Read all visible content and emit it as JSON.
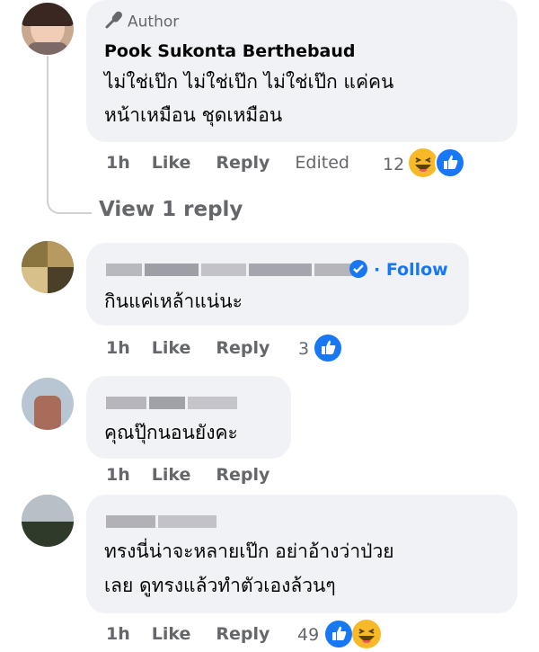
{
  "comment1": {
    "badge": "Author",
    "name": "Pook Sukonta Berthebaud",
    "line1": "ไม่ใช่เป๊ก ไม่ใช่เป๊ก ไม่ใช่เป๊ก แค่คน",
    "line2": "หน้าเหมือน ชุดเหมือน",
    "time": "1h",
    "like": "Like",
    "reply": "Reply",
    "edited": "Edited",
    "reaction_count": "12"
  },
  "view_replies": "View 1 reply",
  "comment2": {
    "follow": "· Follow",
    "text": "กินแค่เหล้าแน่นะ",
    "time": "1h",
    "like": "Like",
    "reply": "Reply",
    "reaction_count": "3"
  },
  "comment3": {
    "text": "คุณปุ๊กนอนยังคะ",
    "time": "1h",
    "like": "Like",
    "reply": "Reply"
  },
  "comment4": {
    "line1": "ทรงนี่น่าจะหลายเป๊ก อย่าอ้างว่าป่วย",
    "line2": "เลย ดูทรงแล้วทำตัวเองล้วนๆ",
    "time": "1h",
    "like": "Like",
    "reply": "Reply",
    "reaction_count": "49"
  },
  "colors": {
    "like_blue": "#1877f2",
    "haha_yellow": "#f7b928",
    "meta_gray": "#65676b",
    "bubble": "#f0f2f5"
  }
}
